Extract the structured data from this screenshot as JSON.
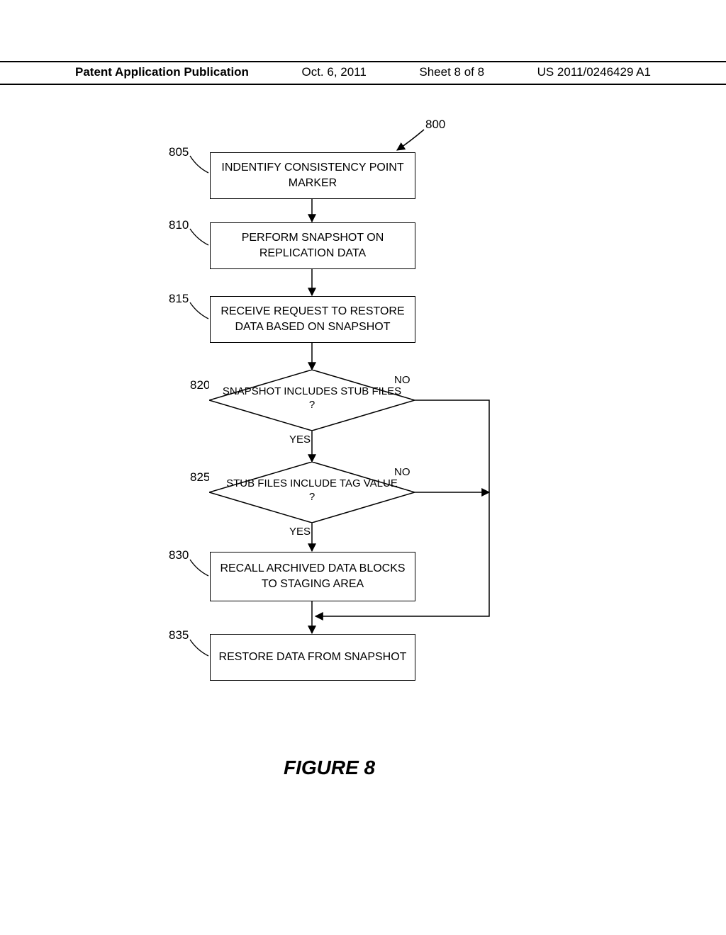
{
  "header": {
    "left": "Patent Application Publication",
    "date": "Oct. 6, 2011",
    "sheet": "Sheet 8 of 8",
    "pubno": "US 2011/0246429 A1"
  },
  "refs": {
    "r800": "800",
    "r805": "805",
    "r810": "810",
    "r815": "815",
    "r820": "820",
    "r825": "825",
    "r830": "830",
    "r835": "835"
  },
  "boxes": {
    "b805": "INDENTIFY CONSISTENCY POINT MARKER",
    "b810": "PERFORM SNAPSHOT ON REPLICATION DATA",
    "b815": "RECEIVE REQUEST TO RESTORE DATA BASED ON SNAPSHOT",
    "b830": "RECALL ARCHIVED DATA BLOCKS TO STAGING AREA",
    "b835": "RESTORE DATA FROM SNAPSHOT"
  },
  "diamonds": {
    "d820": "SNAPSHOT INCLUDES STUB FILES\n?",
    "d825": "STUB FILES INCLUDE TAG VALUE\n?"
  },
  "labels": {
    "yes": "YES",
    "no": "NO"
  },
  "caption": "FIGURE 8"
}
